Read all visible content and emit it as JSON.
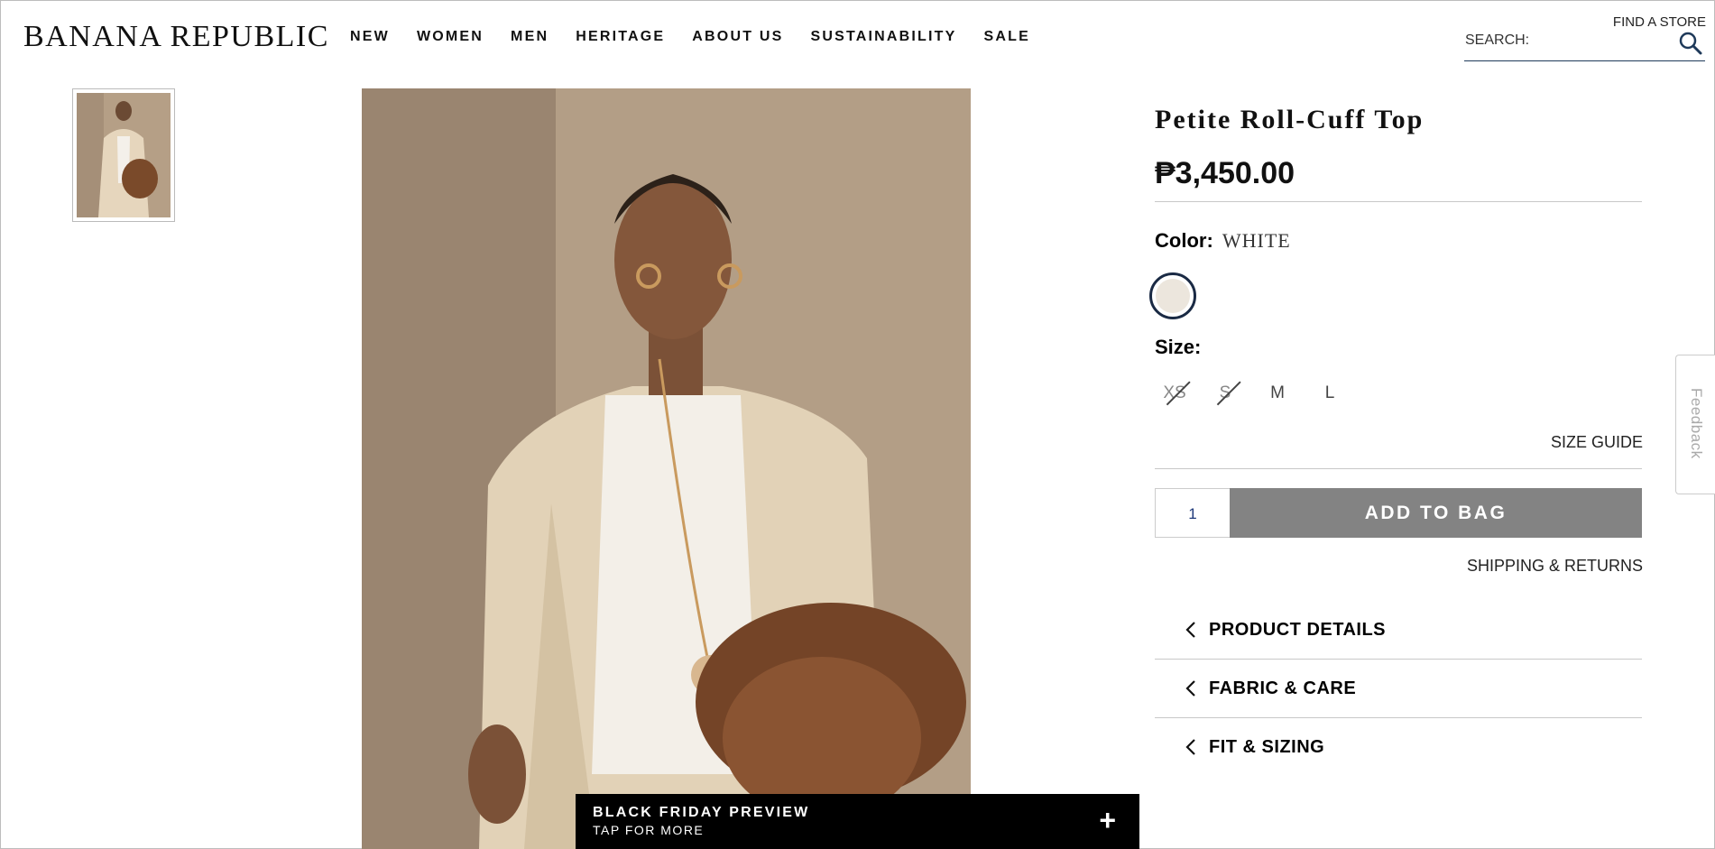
{
  "brand": {
    "name": "BANANA REPUBLIC"
  },
  "nav": {
    "items": [
      "NEW",
      "WOMEN",
      "MEN",
      "HERITAGE",
      "ABOUT US",
      "SUSTAINABILITY",
      "SALE"
    ]
  },
  "header": {
    "find_store": "FIND A STORE",
    "search_placeholder": "SEARCH:"
  },
  "product": {
    "title": "Petite Roll-Cuff Top",
    "price": "₱3,450.00",
    "color_label": "Color:",
    "color_value": "WHITE",
    "size_label": "Size:",
    "sizes": [
      {
        "label": "XS",
        "available": false
      },
      {
        "label": "S",
        "available": false
      },
      {
        "label": "M",
        "available": true
      },
      {
        "label": "L",
        "available": true
      }
    ],
    "size_guide": "SIZE GUIDE",
    "quantity": "1",
    "add_to_bag": "ADD TO BAG",
    "shipping_returns": "SHIPPING & RETURNS"
  },
  "accordion": [
    "PRODUCT DETAILS",
    "FABRIC & CARE",
    "FIT & SIZING"
  ],
  "banner": {
    "title": "BLACK FRIDAY PREVIEW",
    "subtitle": "TAP FOR MORE",
    "action": "+"
  },
  "feedback": {
    "label": "Feedback"
  },
  "colors": {
    "swatch": "#ece6dd",
    "swatch_ring": "#1a2a44",
    "add_button": "#838383",
    "banner_bg": "#000000"
  }
}
